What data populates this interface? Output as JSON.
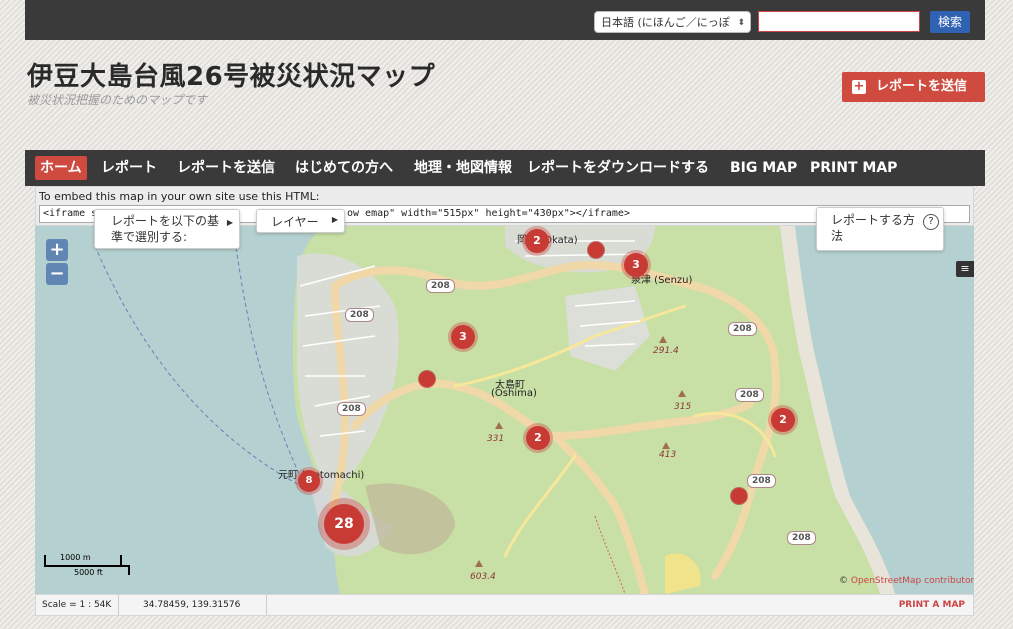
{
  "header": {
    "language_selected": "日本語 (にほんご／にっぽ",
    "search_button": "検索",
    "search_value": "",
    "site_title": "伊豆大島台風26号被災状況マップ",
    "site_tagline": "被災状況把握のためのマップです",
    "submit_report_button": "レポートを送信"
  },
  "nav": {
    "items": [
      "ホーム",
      "レポート",
      "レポートを送信",
      "はじめての方へ",
      "地理・地図情報",
      "レポートをダウンロードする",
      "BIG MAP",
      "PRINT MAP"
    ],
    "active_index": 0
  },
  "embed": {
    "label": "To embed this map in your own site use this HTML:",
    "code_start": "<iframe s",
    "code_end": "ow                              emap\" width=\"515px\" height=\"430px\"></iframe>"
  },
  "map_panels": {
    "filter": "レポートを以下の基準で選別する:",
    "layer": "レイヤー",
    "howto": "レポートする方法"
  },
  "map": {
    "zoom_in": "+",
    "zoom_out": "−",
    "clusters": [
      "2",
      "3",
      "3",
      "2",
      "2",
      "8",
      "28"
    ],
    "place_labels": {
      "okata": "岡田 (Okata)",
      "senzu": "泉津 (Senzu)",
      "oshima_town": "大島町",
      "oshima_town_roman": "(Ōshima)",
      "motomachi": "元町 (Motomachi)"
    },
    "road_number": "208",
    "elevations": [
      "291.4",
      "315",
      "331",
      "413",
      "603.4"
    ],
    "scale_m": "1000 m",
    "scale_ft": "5000 ft",
    "attribution_prefix": "© ",
    "attribution_link": "OpenStreetMap contributors"
  },
  "statusbar": {
    "scale": "Scale = 1 : 54K",
    "coords": "34.78459, 139.31576",
    "print_map": "PRINT A MAP"
  },
  "icons": [
    "plus-icon",
    "chevron-down-icon",
    "chevron-right-icon",
    "help-icon",
    "layers-icon"
  ],
  "colors": {
    "accent_red": "#cf4a3f",
    "dark_bar": "#3a3a3a",
    "search_blue": "#2f62b2",
    "sea": "#b5d0d0",
    "land_green": "#c8dfa6"
  }
}
